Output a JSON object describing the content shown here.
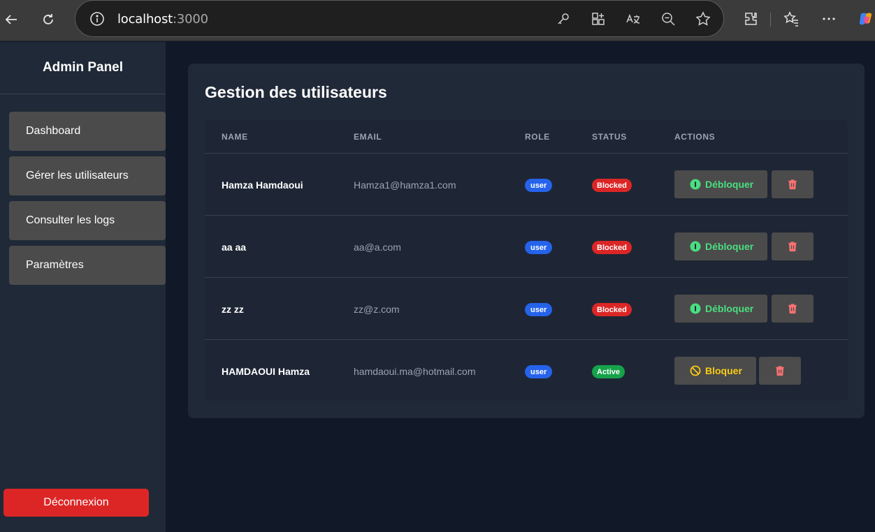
{
  "browser": {
    "url_host": "localhost",
    "url_port": ":3000"
  },
  "sidebar": {
    "title": "Admin Panel",
    "items": [
      {
        "label": "Dashboard"
      },
      {
        "label": "Gérer les utilisateurs"
      },
      {
        "label": "Consulter les logs"
      },
      {
        "label": "Paramètres"
      }
    ],
    "logout_label": "Déconnexion"
  },
  "main": {
    "title": "Gestion des utilisateurs",
    "columns": {
      "name": "NAME",
      "email": "EMAIL",
      "role": "ROLE",
      "status": "STATUS",
      "actions": "ACTIONS"
    },
    "rows": [
      {
        "name": "Hamza Hamdaoui",
        "email": "Hamza1@hamza1.com",
        "role": "user",
        "status": "Blocked",
        "action": "Débloquer"
      },
      {
        "name": "aa aa",
        "email": "aa@a.com",
        "role": "user",
        "status": "Blocked",
        "action": "Débloquer"
      },
      {
        "name": "zz zz",
        "email": "zz@z.com",
        "role": "user",
        "status": "Blocked",
        "action": "Débloquer"
      },
      {
        "name": "HAMDAOUI Hamza",
        "email": "hamdaoui.ma@hotmail.com",
        "role": "user",
        "status": "Active",
        "action": "Bloquer"
      }
    ]
  },
  "colors": {
    "blocked": "#dc2626",
    "active": "#16a34a",
    "unblock_text": "#4ade80",
    "block_text": "#facc15",
    "delete_icon": "#f87171",
    "role_badge": "#2563eb",
    "logout": "#dc2626"
  }
}
